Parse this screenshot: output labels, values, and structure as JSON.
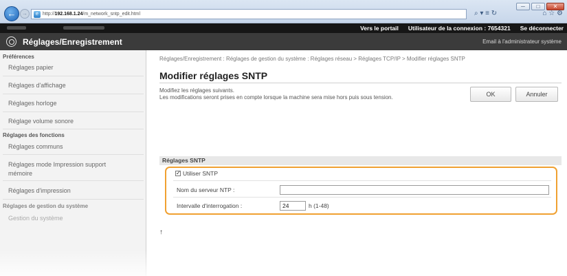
{
  "browser": {
    "url_prefix": "http://",
    "url_host": "192.168.1.24",
    "url_path": "/m_network_sntp_edit.html",
    "tools": "⌕ ▾ ≡ ↻",
    "fav_icons": "⌂ ☆ ⚙",
    "window_buttons": [
      "─",
      "□",
      "✕"
    ]
  },
  "topbar": {
    "portal_link": "Vers le portail",
    "login_user_label": "Utilisateur de la connexion :",
    "login_user_id": "7654321",
    "logout_link": "Se déconnecter"
  },
  "header": {
    "title": "Réglages/Enregistrement",
    "admin_email": "Email à l'administrateur système"
  },
  "sidebar": {
    "section_preferences": "Préférences",
    "items_preferences": [
      "Réglages papier",
      "Réglages d'affichage",
      "Réglages horloge",
      "Réglage volume sonore"
    ],
    "section_functions": "Réglages des fonctions",
    "items_functions": [
      "Réglages communs",
      "Réglages mode Impression support mémoire",
      "Réglages d'impression"
    ],
    "section_system": "Réglages de gestion du système",
    "items_system": [
      "Gestion du système"
    ]
  },
  "main": {
    "breadcrumb": "Réglages/Enregistrement : Réglages de gestion du système : Réglages réseau > Réglages TCP/IP > Modifier réglages SNTP",
    "page_title": "Modifier réglages SNTP",
    "description_line1": "Modifiez les réglages suivants.",
    "description_line2": "Les modifications seront prises en compte lorsque la machine sera mise hors puis sous tension.",
    "ok_label": "OK",
    "cancel_label": "Annuler",
    "section_title": "Réglages SNTP",
    "use_sntp_label": "Utiliser SNTP",
    "use_sntp_checked": true,
    "ntp_server_label": "Nom du serveur NTP :",
    "ntp_server_value": "",
    "interval_label": "Intervalle d'interrogation :",
    "interval_value": "24",
    "interval_unit": "h (1-48)",
    "to_top": "↑"
  },
  "colors": {
    "highlight": "#f0a030",
    "topbar": "#161616",
    "titlestrip": "#3b3b3b"
  }
}
